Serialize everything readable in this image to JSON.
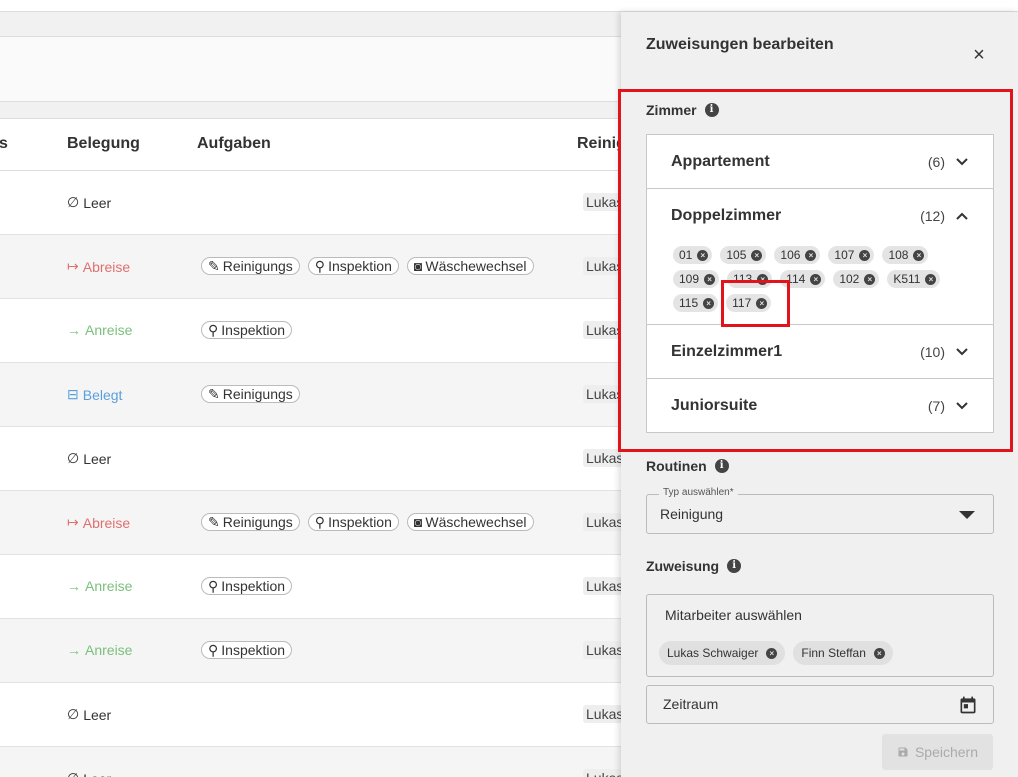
{
  "table": {
    "headers": {
      "status_partial": "s",
      "occupancy": "Belegung",
      "tasks": "Aufgaben",
      "cleaning_partial": "Reinig"
    },
    "rows": [
      {
        "occupancy": "Leer",
        "kind": "leer",
        "tasks": [],
        "cleaner": "Lukas"
      },
      {
        "occupancy": "Abreise",
        "kind": "abreise",
        "tasks": [
          "Reinigungs",
          "Inspektion",
          "Wäschewechsel"
        ],
        "cleaner": "Lukas"
      },
      {
        "occupancy": "Anreise",
        "kind": "anreise",
        "tasks": [
          "Inspektion"
        ],
        "cleaner": "Lukas"
      },
      {
        "occupancy": "Belegt",
        "kind": "belegt",
        "tasks": [
          "Reinigungs"
        ],
        "cleaner": "Lukas"
      },
      {
        "occupancy": "Leer",
        "kind": "leer",
        "tasks": [],
        "cleaner": "Lukas"
      },
      {
        "occupancy": "Abreise",
        "kind": "abreise",
        "tasks": [
          "Reinigungs",
          "Inspektion",
          "Wäschewechsel"
        ],
        "cleaner": "Lukas"
      },
      {
        "occupancy": "Anreise",
        "kind": "anreise",
        "tasks": [
          "Inspektion"
        ],
        "cleaner": "Lukas"
      },
      {
        "occupancy": "Anreise",
        "kind": "anreise",
        "tasks": [
          "Inspektion"
        ],
        "cleaner": "Lukas"
      },
      {
        "occupancy": "Leer",
        "kind": "leer",
        "tasks": [],
        "cleaner": "Lukas"
      },
      {
        "occupancy": "Leer",
        "kind": "leer",
        "tasks": [],
        "cleaner": "Lukas"
      }
    ]
  },
  "drawer": {
    "title": "Zuweisungen bearbeiten",
    "close_symbol": "×",
    "rooms_label": "Zimmer",
    "categories": [
      {
        "name": "Appartement",
        "count": "(6)",
        "expanded": false,
        "rooms": []
      },
      {
        "name": "Doppelzimmer",
        "count": "(12)",
        "expanded": true,
        "rooms": [
          "01",
          "105",
          "106",
          "107",
          "108",
          "109",
          "113",
          "114",
          "102",
          "K511",
          "115",
          "117"
        ]
      },
      {
        "name": "Einzelzimmer1",
        "count": "(10)",
        "expanded": false,
        "rooms": []
      },
      {
        "name": "Juniorsuite",
        "count": "(7)",
        "expanded": false,
        "rooms": []
      }
    ],
    "routines_label": "Routinen",
    "type_select": {
      "legend": "Typ auswählen*",
      "value": "Reinigung"
    },
    "assignment_label": "Zuweisung",
    "employee_select": {
      "placeholder": "Mitarbeiter auswählen",
      "selected": [
        "Lukas Schwaiger",
        "Finn Steffan"
      ]
    },
    "date_range": {
      "placeholder": "Zeitraum"
    },
    "save_label": "Speichern"
  },
  "colors": {
    "highlight": "#e0141a",
    "abreise": "#e07070",
    "anreise": "#7cbf7c",
    "belegt": "#5a9fdc"
  }
}
